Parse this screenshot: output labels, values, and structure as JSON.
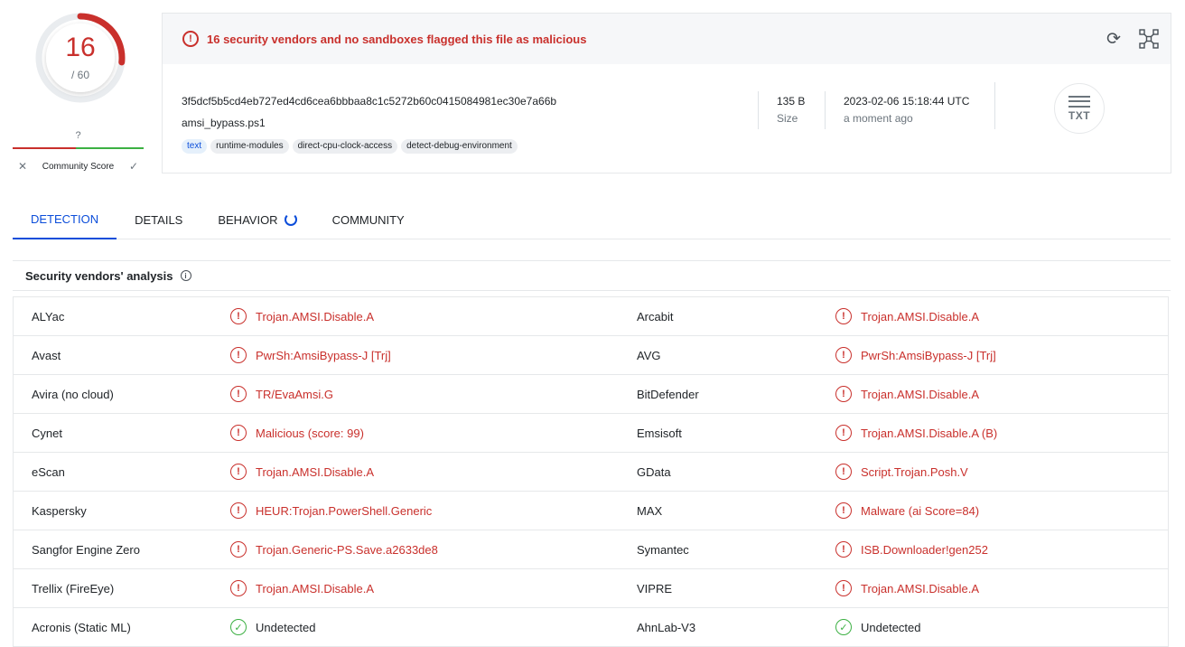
{
  "score": {
    "detections": "16",
    "total": "/ 60",
    "fraction": 0.2667,
    "community_value": "?",
    "community_label": "Community Score"
  },
  "summary": {
    "alert": "16 security vendors and no sandboxes flagged this file as malicious",
    "hash": "3f5dcf5b5cd4eb727ed4cd6cea6bbbaa8c1c5272b60c0415084981ec30e7a66b",
    "filename": "amsi_bypass.ps1",
    "tags": [
      "text",
      "runtime-modules",
      "direct-cpu-clock-access",
      "detect-debug-environment"
    ],
    "size_value": "135 B",
    "size_label": "Size",
    "date_value": "2023-02-06 15:18:44 UTC",
    "date_ago": "a moment ago",
    "file_type": "TXT"
  },
  "tabs": [
    {
      "label": "DETECTION"
    },
    {
      "label": "DETAILS"
    },
    {
      "label": "BEHAVIOR"
    },
    {
      "label": "COMMUNITY"
    }
  ],
  "analysis": {
    "title": "Security vendors' analysis",
    "rows": [
      {
        "v1": "ALYac",
        "r1": "Trojan.AMSI.Disable.A",
        "s1": "bad",
        "v2": "Arcabit",
        "r2": "Trojan.AMSI.Disable.A",
        "s2": "bad"
      },
      {
        "v1": "Avast",
        "r1": "PwrSh:AmsiBypass-J [Trj]",
        "s1": "bad",
        "v2": "AVG",
        "r2": "PwrSh:AmsiBypass-J [Trj]",
        "s2": "bad"
      },
      {
        "v1": "Avira (no cloud)",
        "r1": "TR/EvaAmsi.G",
        "s1": "bad",
        "v2": "BitDefender",
        "r2": "Trojan.AMSI.Disable.A",
        "s2": "bad"
      },
      {
        "v1": "Cynet",
        "r1": "Malicious (score: 99)",
        "s1": "bad",
        "v2": "Emsisoft",
        "r2": "Trojan.AMSI.Disable.A (B)",
        "s2": "bad"
      },
      {
        "v1": "eScan",
        "r1": "Trojan.AMSI.Disable.A",
        "s1": "bad",
        "v2": "GData",
        "r2": "Script.Trojan.Posh.V",
        "s2": "bad"
      },
      {
        "v1": "Kaspersky",
        "r1": "HEUR:Trojan.PowerShell.Generic",
        "s1": "bad",
        "v2": "MAX",
        "r2": "Malware (ai Score=84)",
        "s2": "bad"
      },
      {
        "v1": "Sangfor Engine Zero",
        "r1": "Trojan.Generic-PS.Save.a2633de8",
        "s1": "bad",
        "v2": "Symantec",
        "r2": "ISB.Downloader!gen252",
        "s2": "bad"
      },
      {
        "v1": "Trellix (FireEye)",
        "r1": "Trojan.AMSI.Disable.A",
        "s1": "bad",
        "v2": "VIPRE",
        "r2": "Trojan.AMSI.Disable.A",
        "s2": "bad"
      },
      {
        "v1": "Acronis (Static ML)",
        "r1": "Undetected",
        "s1": "good",
        "v2": "AhnLab-V3",
        "r2": "Undetected",
        "s2": "good"
      }
    ]
  },
  "colors": {
    "malicious": "#c9302c",
    "clean": "#3cb043",
    "accent": "#0b4dda"
  }
}
